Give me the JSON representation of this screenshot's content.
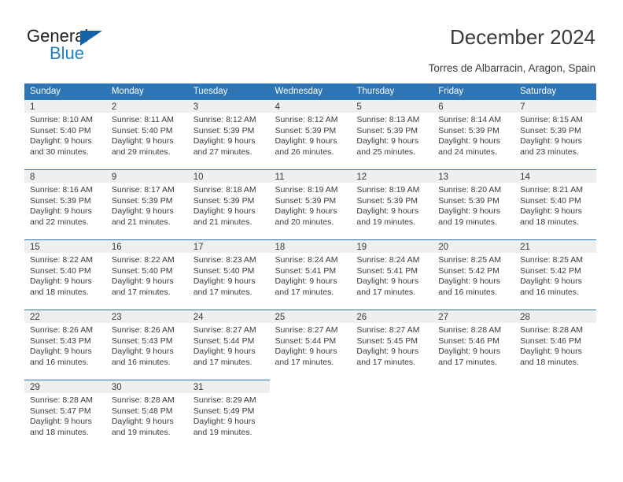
{
  "brand": {
    "name_top": "General",
    "name_bottom": "Blue",
    "triangle_icon": "blue-triangle-logo-mark",
    "accent_color": "#1f7ec4"
  },
  "header": {
    "title": "December 2024",
    "subtitle": "Torres de Albarracin, Aragon, Spain"
  },
  "calendar": {
    "header_bg": "#2e75b6",
    "daynum_bg": "#efefef",
    "weekdays": [
      "Sunday",
      "Monday",
      "Tuesday",
      "Wednesday",
      "Thursday",
      "Friday",
      "Saturday"
    ],
    "labels": {
      "sunrise": "Sunrise:",
      "sunset": "Sunset:",
      "daylight": "Daylight:"
    },
    "weeks": [
      [
        {
          "day": "1",
          "sunrise": "Sunrise: 8:10 AM",
          "sunset": "Sunset: 5:40 PM",
          "daylight1": "Daylight: 9 hours",
          "daylight2": "and 30 minutes."
        },
        {
          "day": "2",
          "sunrise": "Sunrise: 8:11 AM",
          "sunset": "Sunset: 5:40 PM",
          "daylight1": "Daylight: 9 hours",
          "daylight2": "and 29 minutes."
        },
        {
          "day": "3",
          "sunrise": "Sunrise: 8:12 AM",
          "sunset": "Sunset: 5:39 PM",
          "daylight1": "Daylight: 9 hours",
          "daylight2": "and 27 minutes."
        },
        {
          "day": "4",
          "sunrise": "Sunrise: 8:12 AM",
          "sunset": "Sunset: 5:39 PM",
          "daylight1": "Daylight: 9 hours",
          "daylight2": "and 26 minutes."
        },
        {
          "day": "5",
          "sunrise": "Sunrise: 8:13 AM",
          "sunset": "Sunset: 5:39 PM",
          "daylight1": "Daylight: 9 hours",
          "daylight2": "and 25 minutes."
        },
        {
          "day": "6",
          "sunrise": "Sunrise: 8:14 AM",
          "sunset": "Sunset: 5:39 PM",
          "daylight1": "Daylight: 9 hours",
          "daylight2": "and 24 minutes."
        },
        {
          "day": "7",
          "sunrise": "Sunrise: 8:15 AM",
          "sunset": "Sunset: 5:39 PM",
          "daylight1": "Daylight: 9 hours",
          "daylight2": "and 23 minutes."
        }
      ],
      [
        {
          "day": "8",
          "sunrise": "Sunrise: 8:16 AM",
          "sunset": "Sunset: 5:39 PM",
          "daylight1": "Daylight: 9 hours",
          "daylight2": "and 22 minutes."
        },
        {
          "day": "9",
          "sunrise": "Sunrise: 8:17 AM",
          "sunset": "Sunset: 5:39 PM",
          "daylight1": "Daylight: 9 hours",
          "daylight2": "and 21 minutes."
        },
        {
          "day": "10",
          "sunrise": "Sunrise: 8:18 AM",
          "sunset": "Sunset: 5:39 PM",
          "daylight1": "Daylight: 9 hours",
          "daylight2": "and 21 minutes."
        },
        {
          "day": "11",
          "sunrise": "Sunrise: 8:19 AM",
          "sunset": "Sunset: 5:39 PM",
          "daylight1": "Daylight: 9 hours",
          "daylight2": "and 20 minutes."
        },
        {
          "day": "12",
          "sunrise": "Sunrise: 8:19 AM",
          "sunset": "Sunset: 5:39 PM",
          "daylight1": "Daylight: 9 hours",
          "daylight2": "and 19 minutes."
        },
        {
          "day": "13",
          "sunrise": "Sunrise: 8:20 AM",
          "sunset": "Sunset: 5:39 PM",
          "daylight1": "Daylight: 9 hours",
          "daylight2": "and 19 minutes."
        },
        {
          "day": "14",
          "sunrise": "Sunrise: 8:21 AM",
          "sunset": "Sunset: 5:40 PM",
          "daylight1": "Daylight: 9 hours",
          "daylight2": "and 18 minutes."
        }
      ],
      [
        {
          "day": "15",
          "sunrise": "Sunrise: 8:22 AM",
          "sunset": "Sunset: 5:40 PM",
          "daylight1": "Daylight: 9 hours",
          "daylight2": "and 18 minutes."
        },
        {
          "day": "16",
          "sunrise": "Sunrise: 8:22 AM",
          "sunset": "Sunset: 5:40 PM",
          "daylight1": "Daylight: 9 hours",
          "daylight2": "and 17 minutes."
        },
        {
          "day": "17",
          "sunrise": "Sunrise: 8:23 AM",
          "sunset": "Sunset: 5:40 PM",
          "daylight1": "Daylight: 9 hours",
          "daylight2": "and 17 minutes."
        },
        {
          "day": "18",
          "sunrise": "Sunrise: 8:24 AM",
          "sunset": "Sunset: 5:41 PM",
          "daylight1": "Daylight: 9 hours",
          "daylight2": "and 17 minutes."
        },
        {
          "day": "19",
          "sunrise": "Sunrise: 8:24 AM",
          "sunset": "Sunset: 5:41 PM",
          "daylight1": "Daylight: 9 hours",
          "daylight2": "and 17 minutes."
        },
        {
          "day": "20",
          "sunrise": "Sunrise: 8:25 AM",
          "sunset": "Sunset: 5:42 PM",
          "daylight1": "Daylight: 9 hours",
          "daylight2": "and 16 minutes."
        },
        {
          "day": "21",
          "sunrise": "Sunrise: 8:25 AM",
          "sunset": "Sunset: 5:42 PM",
          "daylight1": "Daylight: 9 hours",
          "daylight2": "and 16 minutes."
        }
      ],
      [
        {
          "day": "22",
          "sunrise": "Sunrise: 8:26 AM",
          "sunset": "Sunset: 5:43 PM",
          "daylight1": "Daylight: 9 hours",
          "daylight2": "and 16 minutes."
        },
        {
          "day": "23",
          "sunrise": "Sunrise: 8:26 AM",
          "sunset": "Sunset: 5:43 PM",
          "daylight1": "Daylight: 9 hours",
          "daylight2": "and 16 minutes."
        },
        {
          "day": "24",
          "sunrise": "Sunrise: 8:27 AM",
          "sunset": "Sunset: 5:44 PM",
          "daylight1": "Daylight: 9 hours",
          "daylight2": "and 17 minutes."
        },
        {
          "day": "25",
          "sunrise": "Sunrise: 8:27 AM",
          "sunset": "Sunset: 5:44 PM",
          "daylight1": "Daylight: 9 hours",
          "daylight2": "and 17 minutes."
        },
        {
          "day": "26",
          "sunrise": "Sunrise: 8:27 AM",
          "sunset": "Sunset: 5:45 PM",
          "daylight1": "Daylight: 9 hours",
          "daylight2": "and 17 minutes."
        },
        {
          "day": "27",
          "sunrise": "Sunrise: 8:28 AM",
          "sunset": "Sunset: 5:46 PM",
          "daylight1": "Daylight: 9 hours",
          "daylight2": "and 17 minutes."
        },
        {
          "day": "28",
          "sunrise": "Sunrise: 8:28 AM",
          "sunset": "Sunset: 5:46 PM",
          "daylight1": "Daylight: 9 hours",
          "daylight2": "and 18 minutes."
        }
      ],
      [
        {
          "day": "29",
          "sunrise": "Sunrise: 8:28 AM",
          "sunset": "Sunset: 5:47 PM",
          "daylight1": "Daylight: 9 hours",
          "daylight2": "and 18 minutes."
        },
        {
          "day": "30",
          "sunrise": "Sunrise: 8:28 AM",
          "sunset": "Sunset: 5:48 PM",
          "daylight1": "Daylight: 9 hours",
          "daylight2": "and 19 minutes."
        },
        {
          "day": "31",
          "sunrise": "Sunrise: 8:29 AM",
          "sunset": "Sunset: 5:49 PM",
          "daylight1": "Daylight: 9 hours",
          "daylight2": "and 19 minutes."
        },
        {
          "day": "",
          "sunrise": "",
          "sunset": "",
          "daylight1": "",
          "daylight2": ""
        },
        {
          "day": "",
          "sunrise": "",
          "sunset": "",
          "daylight1": "",
          "daylight2": ""
        },
        {
          "day": "",
          "sunrise": "",
          "sunset": "",
          "daylight1": "",
          "daylight2": ""
        },
        {
          "day": "",
          "sunrise": "",
          "sunset": "",
          "daylight1": "",
          "daylight2": ""
        }
      ]
    ]
  }
}
